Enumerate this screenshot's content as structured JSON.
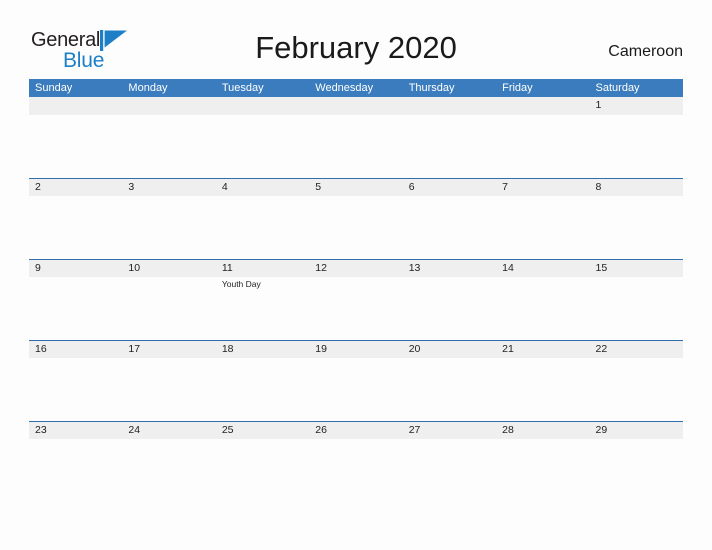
{
  "brand": {
    "name_part1": "General",
    "name_part2": "Blue",
    "color_dark": "#231f20",
    "color_blue": "#1f7fc6",
    "flag_icon": "blue-triangle-flag-icon"
  },
  "header": {
    "title": "February 2020",
    "country": "Cameroon"
  },
  "theme": {
    "header_blue": "#3a7cbd",
    "row_border_blue": "#2f6fae",
    "date_strip_gray": "#efefef",
    "page_background": "#fdfdfd",
    "text_dark": "#222222"
  },
  "calendar": {
    "month": "February",
    "year": "2020",
    "weekdays": [
      "Sunday",
      "Monday",
      "Tuesday",
      "Wednesday",
      "Thursday",
      "Friday",
      "Saturday"
    ],
    "weeks": [
      {
        "days": [
          {
            "date": "",
            "events": []
          },
          {
            "date": "",
            "events": []
          },
          {
            "date": "",
            "events": []
          },
          {
            "date": "",
            "events": []
          },
          {
            "date": "",
            "events": []
          },
          {
            "date": "",
            "events": []
          },
          {
            "date": "1",
            "events": []
          }
        ]
      },
      {
        "days": [
          {
            "date": "2",
            "events": []
          },
          {
            "date": "3",
            "events": []
          },
          {
            "date": "4",
            "events": []
          },
          {
            "date": "5",
            "events": []
          },
          {
            "date": "6",
            "events": []
          },
          {
            "date": "7",
            "events": []
          },
          {
            "date": "8",
            "events": []
          }
        ]
      },
      {
        "days": [
          {
            "date": "9",
            "events": []
          },
          {
            "date": "10",
            "events": []
          },
          {
            "date": "11",
            "events": [
              "Youth Day"
            ]
          },
          {
            "date": "12",
            "events": []
          },
          {
            "date": "13",
            "events": []
          },
          {
            "date": "14",
            "events": []
          },
          {
            "date": "15",
            "events": []
          }
        ]
      },
      {
        "days": [
          {
            "date": "16",
            "events": []
          },
          {
            "date": "17",
            "events": []
          },
          {
            "date": "18",
            "events": []
          },
          {
            "date": "19",
            "events": []
          },
          {
            "date": "20",
            "events": []
          },
          {
            "date": "21",
            "events": []
          },
          {
            "date": "22",
            "events": []
          }
        ]
      },
      {
        "days": [
          {
            "date": "23",
            "events": []
          },
          {
            "date": "24",
            "events": []
          },
          {
            "date": "25",
            "events": []
          },
          {
            "date": "26",
            "events": []
          },
          {
            "date": "27",
            "events": []
          },
          {
            "date": "28",
            "events": []
          },
          {
            "date": "29",
            "events": []
          }
        ]
      }
    ]
  }
}
